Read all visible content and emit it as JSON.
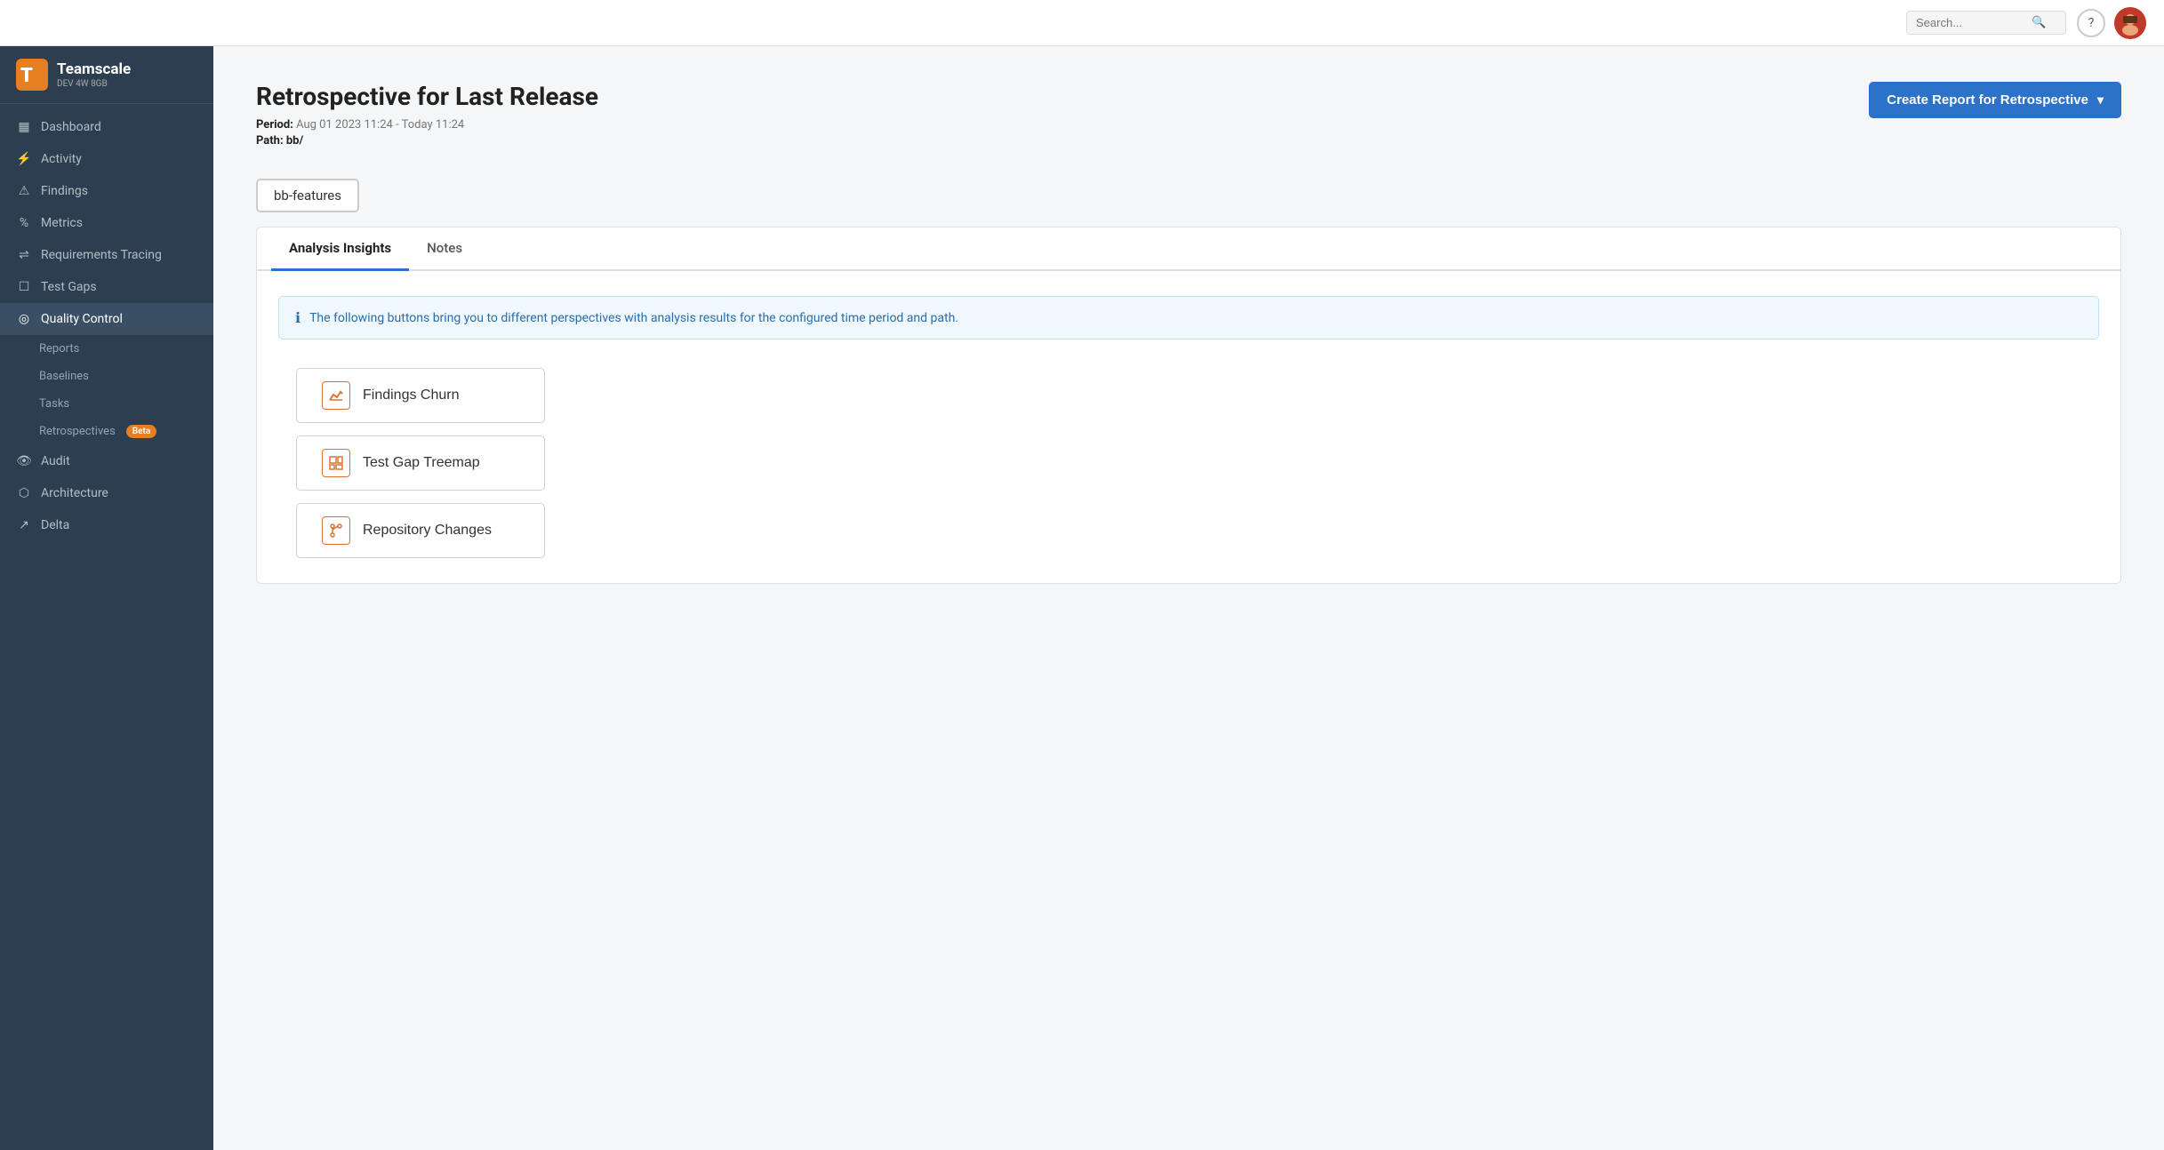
{
  "topbar": {
    "search_placeholder": "Search...",
    "help_label": "?",
    "avatar_emoji": "👨"
  },
  "sidebar": {
    "logo_name": "Teamscale",
    "logo_sub": "DEV 4W 8GB",
    "nav_items": [
      {
        "id": "dashboard",
        "label": "Dashboard",
        "icon": "▦"
      },
      {
        "id": "activity",
        "label": "Activity",
        "icon": "⚡"
      },
      {
        "id": "findings",
        "label": "Findings",
        "icon": "⚠"
      },
      {
        "id": "metrics",
        "label": "Metrics",
        "icon": "%"
      },
      {
        "id": "requirements",
        "label": "Requirements Tracing",
        "icon": "⇌"
      },
      {
        "id": "test-gaps",
        "label": "Test Gaps",
        "icon": "☐"
      },
      {
        "id": "quality-control",
        "label": "Quality Control",
        "icon": "◎",
        "active": true
      },
      {
        "id": "audit",
        "label": "Audit",
        "icon": "👁"
      },
      {
        "id": "architecture",
        "label": "Architecture",
        "icon": "⬡"
      },
      {
        "id": "delta",
        "label": "Delta",
        "icon": "↗"
      }
    ],
    "sub_items": [
      {
        "id": "reports",
        "label": "Reports"
      },
      {
        "id": "baselines",
        "label": "Baselines"
      },
      {
        "id": "tasks",
        "label": "Tasks"
      },
      {
        "id": "retrospectives",
        "label": "Retrospectives",
        "badge": "Beta"
      }
    ]
  },
  "page": {
    "title": "Retrospective for Last Release",
    "period_label": "Period:",
    "period_value": "Aug 01 2023 11:24 - Today 11:24",
    "path_label": "Path:",
    "path_value": "bb/"
  },
  "create_report_btn": "Create Report for Retrospective",
  "branch_selector": "bb-features",
  "tabs": [
    {
      "id": "analysis-insights",
      "label": "Analysis Insights",
      "active": true
    },
    {
      "id": "notes",
      "label": "Notes",
      "active": false
    }
  ],
  "info_banner": "The following buttons bring you to different perspectives with analysis results for the configured time period and path.",
  "action_buttons": [
    {
      "id": "findings-churn",
      "label": "Findings Churn",
      "icon": "📈"
    },
    {
      "id": "test-gap-treemap",
      "label": "Test Gap Treemap",
      "icon": "⊞"
    },
    {
      "id": "repository-changes",
      "label": "Repository Changes",
      "icon": "⑂"
    }
  ]
}
